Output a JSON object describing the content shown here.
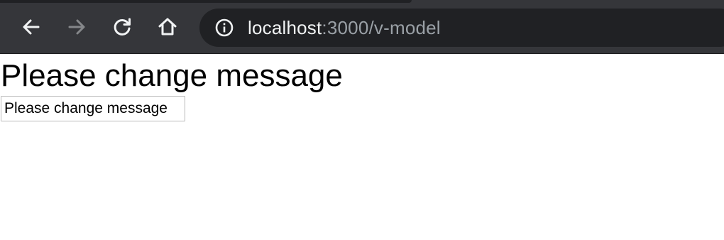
{
  "browser": {
    "url_host": "localhost",
    "url_rest": ":3000/v-model",
    "toolbar_color": "#35363a",
    "omnibox_color": "#202124",
    "icons": {
      "back": "arrow-left-icon",
      "forward": "arrow-right-icon",
      "reload": "reload-icon",
      "home": "home-icon",
      "site_info": "info-circle-icon"
    }
  },
  "page": {
    "heading": "Please change message",
    "input_value": "Please change message"
  }
}
